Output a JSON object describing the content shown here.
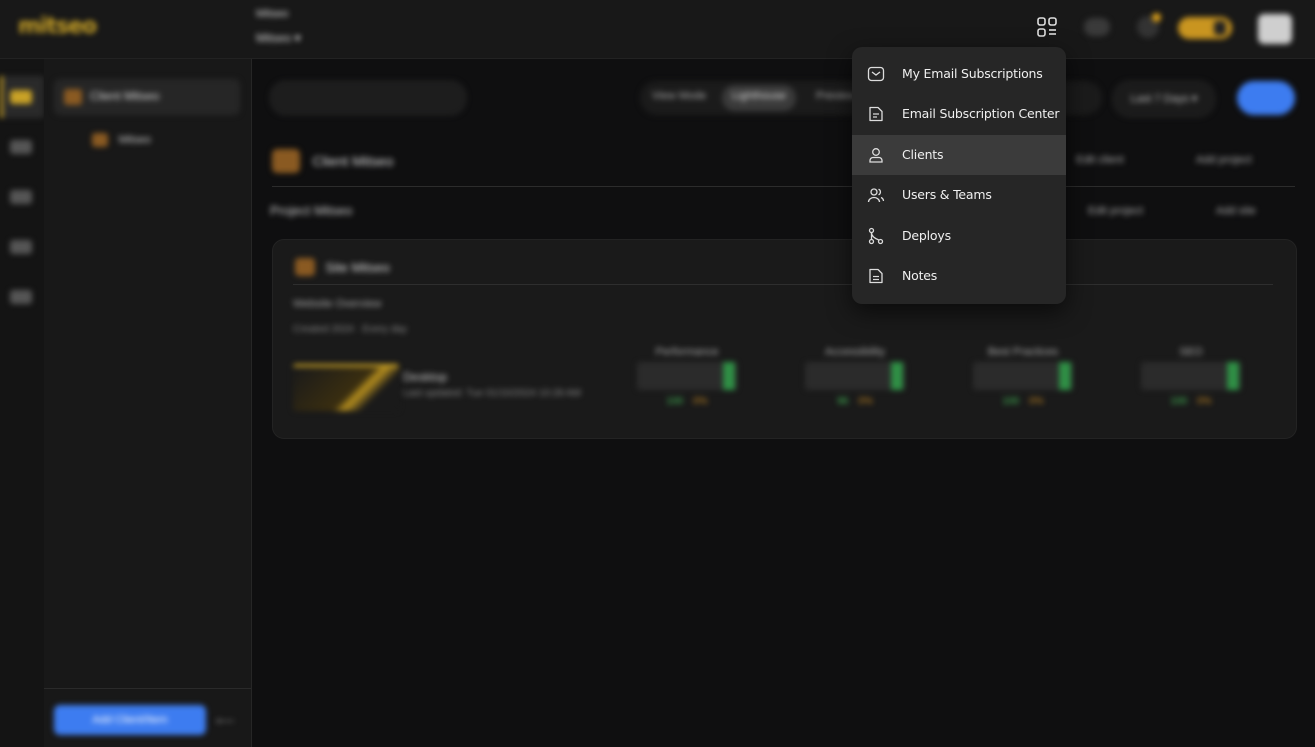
{
  "topbar": {
    "logo": "mitseo",
    "breadcrumb_top": "Mitseo",
    "breadcrumb_sub": "Mitseo ▾"
  },
  "rail": {
    "icons": [
      "database-icon",
      "grid-icon",
      "monitor-icon",
      "users-icon",
      "chat-icon"
    ]
  },
  "tree": {
    "client_label": "Client Mitseo",
    "child_label": "Mitseo",
    "add_button": "Add Client/Item",
    "collapse_icon": "arrow-left-icon"
  },
  "main": {
    "tabs": [
      "View Mode",
      "Lighthouse",
      "Preview"
    ],
    "select_label": "Last 7 Days ▾",
    "client_title": "Client Mitseo",
    "actions": [
      "Edit client",
      "Add project"
    ],
    "project_label": "Project Mitseo",
    "project_actions": [
      "Edit project",
      "Add site"
    ],
    "card": {
      "title": "Site Mitseo",
      "subtitle": "Website Overview",
      "meta": "Created 2024 · Every day",
      "site_name": "Desktop",
      "site_date": "Last updated: Tue 01/10/2024 10:28 AM",
      "metrics": [
        {
          "name": "Performance",
          "good": "100",
          "delta": "0%"
        },
        {
          "name": "Accessibility",
          "good": "96",
          "delta": "0%"
        },
        {
          "name": "Best Practices",
          "good": "100",
          "delta": "0%"
        },
        {
          "name": "SEO",
          "good": "100",
          "delta": "0%"
        }
      ]
    }
  },
  "menu": {
    "items": [
      {
        "label": "My Email Subscriptions",
        "icon": "envelope-icon"
      },
      {
        "label": "Email Subscription Center",
        "icon": "document-icon"
      },
      {
        "label": "Clients",
        "icon": "user-icon"
      },
      {
        "label": "Users & Teams",
        "icon": "users-icon"
      },
      {
        "label": "Deploys",
        "icon": "git-branch-icon"
      },
      {
        "label": "Notes",
        "icon": "note-icon"
      }
    ],
    "active_index": 2
  },
  "colors": {
    "accent_gold": "#c9a227",
    "primary_blue": "#3d7cf0",
    "menu_bg": "#262626"
  }
}
